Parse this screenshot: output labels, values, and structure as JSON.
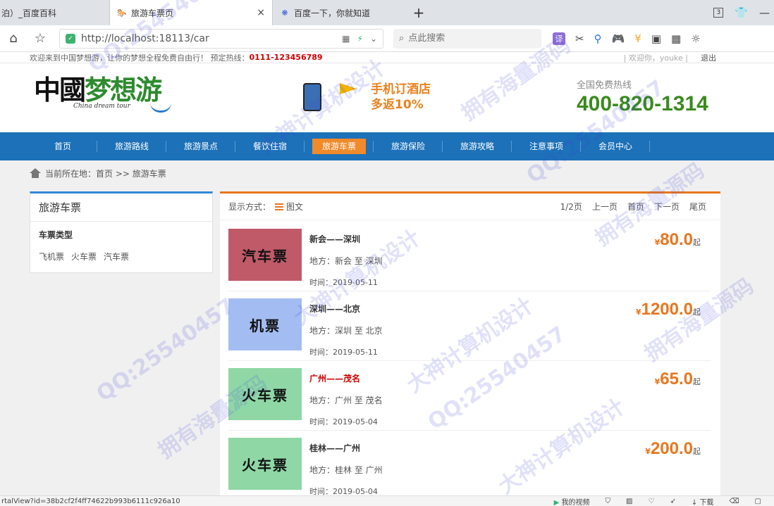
{
  "browser": {
    "tabs": [
      {
        "label": "泊）_百度百科",
        "icon": "document-icon"
      },
      {
        "label": "旅游车票页",
        "icon": "horse-icon",
        "close": "×"
      },
      {
        "label": "百度一下，你就知道",
        "icon": "paw-icon"
      }
    ],
    "new_tab": "+",
    "tab_count": "3",
    "url": "http://localhost:18113/car",
    "search_placeholder": "点此搜索",
    "translate_label": "译"
  },
  "site": {
    "welcome": "欢迎来到中国梦想游，让你的梦想全程免费自由行！ 预定热线：",
    "hotline": "0111-123456789",
    "user_text": "| 欢迎你，youke |",
    "logout": "退出",
    "logo_cn_a": "中國",
    "logo_cn_b": "梦想游",
    "logo_en": "China dream tour",
    "promo_line1": "手机订酒店",
    "promo_line2": "多返10%",
    "hot_label": "全国免费热线",
    "hot_number": "400-820-1314"
  },
  "nav": [
    {
      "label": "首页"
    },
    {
      "label": "旅游路线"
    },
    {
      "label": "旅游景点"
    },
    {
      "label": "餐饮住宿"
    },
    {
      "label": "旅游车票",
      "active": true
    },
    {
      "label": "旅游保险"
    },
    {
      "label": "旅游攻略"
    },
    {
      "label": "注意事项"
    },
    {
      "label": "会员中心"
    }
  ],
  "breadcrumb": "当前所在地：首页 >> 旅游车票",
  "sidebar": {
    "title": "旅游车票",
    "type_title": "车票类型",
    "links": [
      "飞机票",
      "火车票",
      "汽车票"
    ]
  },
  "list_header": {
    "display_label": "显示方式：",
    "mode": "图文",
    "page_info": "1/2页",
    "prev": "上一页",
    "first": "首页",
    "next": "下一页",
    "last": "尾页"
  },
  "items": [
    {
      "thumb_label": "汽车票",
      "thumb_color": "#c05a68",
      "route": "新会——深圳",
      "place": "地方：新会 至 深圳",
      "time": "时间：2019-05-11",
      "currency": "¥",
      "price": "80.0",
      "suffix": "起"
    },
    {
      "thumb_label": "机票",
      "thumb_color": "#a3bdf2",
      "route": "深圳——北京",
      "place": "地方：深圳 至 北京",
      "time": "时间：2019-05-11",
      "currency": "¥",
      "price": "1200.0",
      "suffix": "起"
    },
    {
      "thumb_label": "火车票",
      "thumb_color": "#8fd8a6",
      "route": "广州——茂名",
      "place": "地方：广州 至 茂名",
      "time": "时间：2019-05-04",
      "currency": "¥",
      "price": "65.0",
      "suffix": "起",
      "highlight": true
    },
    {
      "thumb_label": "火车票",
      "thumb_color": "#8fd8a6",
      "route": "桂林——广州",
      "place": "地方：桂林 至 广州",
      "time": "时间：2019-05-04",
      "currency": "¥",
      "price": "200.0",
      "suffix": "起"
    }
  ],
  "statusbar": {
    "url": "rtalView?id=38b2cf2f4ff74622b993b6111c926a10",
    "video": "我的视频",
    "download": "下载"
  },
  "watermarks": [
    "QQ:2545404",
    "拥有海量源码",
    "大神计算机设计",
    "QQ:25540457",
    "拥有海量源码",
    "大神计算机设计",
    "QQ:25540457",
    "拥有海量源码",
    "大神计算机设计",
    "QQ:25540457",
    "拥有海量源码",
    "大神计算机设计"
  ]
}
